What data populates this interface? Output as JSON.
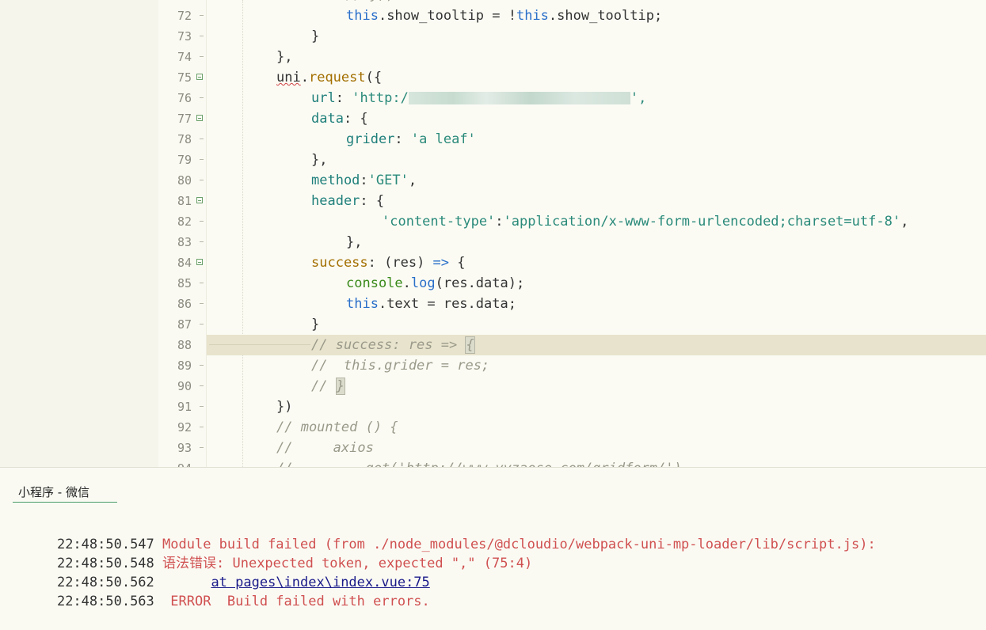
{
  "editor": {
    "lines": [
      {
        "n": "72",
        "fold": false
      },
      {
        "n": "73",
        "fold": false
      },
      {
        "n": "74",
        "fold": false
      },
      {
        "n": "75",
        "fold": true
      },
      {
        "n": "76",
        "fold": false
      },
      {
        "n": "77",
        "fold": true
      },
      {
        "n": "78",
        "fold": false
      },
      {
        "n": "79",
        "fold": false
      },
      {
        "n": "80",
        "fold": false
      },
      {
        "n": "81",
        "fold": true
      },
      {
        "n": "82",
        "fold": false
      },
      {
        "n": "83",
        "fold": false
      },
      {
        "n": "84",
        "fold": true
      },
      {
        "n": "85",
        "fold": false
      },
      {
        "n": "86",
        "fold": false
      },
      {
        "n": "87",
        "fold": false
      },
      {
        "n": "88",
        "fold": false
      },
      {
        "n": "89",
        "fold": false
      },
      {
        "n": "90",
        "fold": false
      },
      {
        "n": "91",
        "fold": false
      },
      {
        "n": "92",
        "fold": false
      },
      {
        "n": "93",
        "fold": false
      }
    ],
    "code": {
      "l72_a": "this",
      "l72_b": ".show_tooltip = !",
      "l72_c": "this",
      "l72_d": ".show_tooltip;",
      "l73": "}",
      "l74": "},",
      "l75_obj": "uni",
      "l75_dot": ".",
      "l75_fn": "request",
      "l75_rest": "({",
      "l76_key": "url",
      "l76_colon": ": ",
      "l76_str": "'http:/",
      "l76_end": "',",
      "l77_key": "data",
      "l77_rest": ": {",
      "l78_key": "grider",
      "l78_colon": ": ",
      "l78_str": "'a leaf'",
      "l79": "},",
      "l80_key": "method",
      "l80_colon": ":",
      "l80_str": "'GET'",
      "l80_end": ",",
      "l81_key": "header",
      "l81_rest": ": {",
      "l82_k": "'content-type'",
      "l82_colon": ":",
      "l82_v": "'application/x-www-form-urlencoded;charset=utf-8'",
      "l82_end": ",",
      "l83": "},",
      "l84_key": "success",
      "l84_mid": ": (res) ",
      "l84_arrow": "=>",
      "l84_end": " {",
      "l85_console": "console",
      "l85_dot": ".",
      "l85_fn": "log",
      "l85_rest": "(res.data);",
      "l86_this": "this",
      "l86_rest": ".text = res.data;",
      "l87": "}",
      "l88_a": "// success: res => ",
      "l88_b": "{",
      "l89": "//  this.grider = res;",
      "l90_a": "// ",
      "l90_b": "}",
      "l91": "})",
      "l92": "// mounted () {",
      "l93": "//     axios"
    }
  },
  "console": {
    "tab_label": "小程序 - 微信",
    "logs": [
      {
        "time": "22:48:50.547",
        "msg": " Module build failed (from ./node_modules/@dcloudio/webpack-uni-mp-loader/lib/script.js):"
      },
      {
        "time": "22:48:50.548",
        "msg": " 语法错误: Unexpected token, expected \",\" (75:4)"
      },
      {
        "time": "22:48:50.562",
        "indent": "       ",
        "link": "at pages\\index\\index.vue:75"
      },
      {
        "time": "22:48:50.563",
        "msg": "  ERROR  Build failed with errors."
      }
    ]
  },
  "colors": {
    "error_text": "#d05050",
    "keyword": "#2a6fc9",
    "string": "#2a8a7a",
    "current_line": "#e8e3cc"
  }
}
